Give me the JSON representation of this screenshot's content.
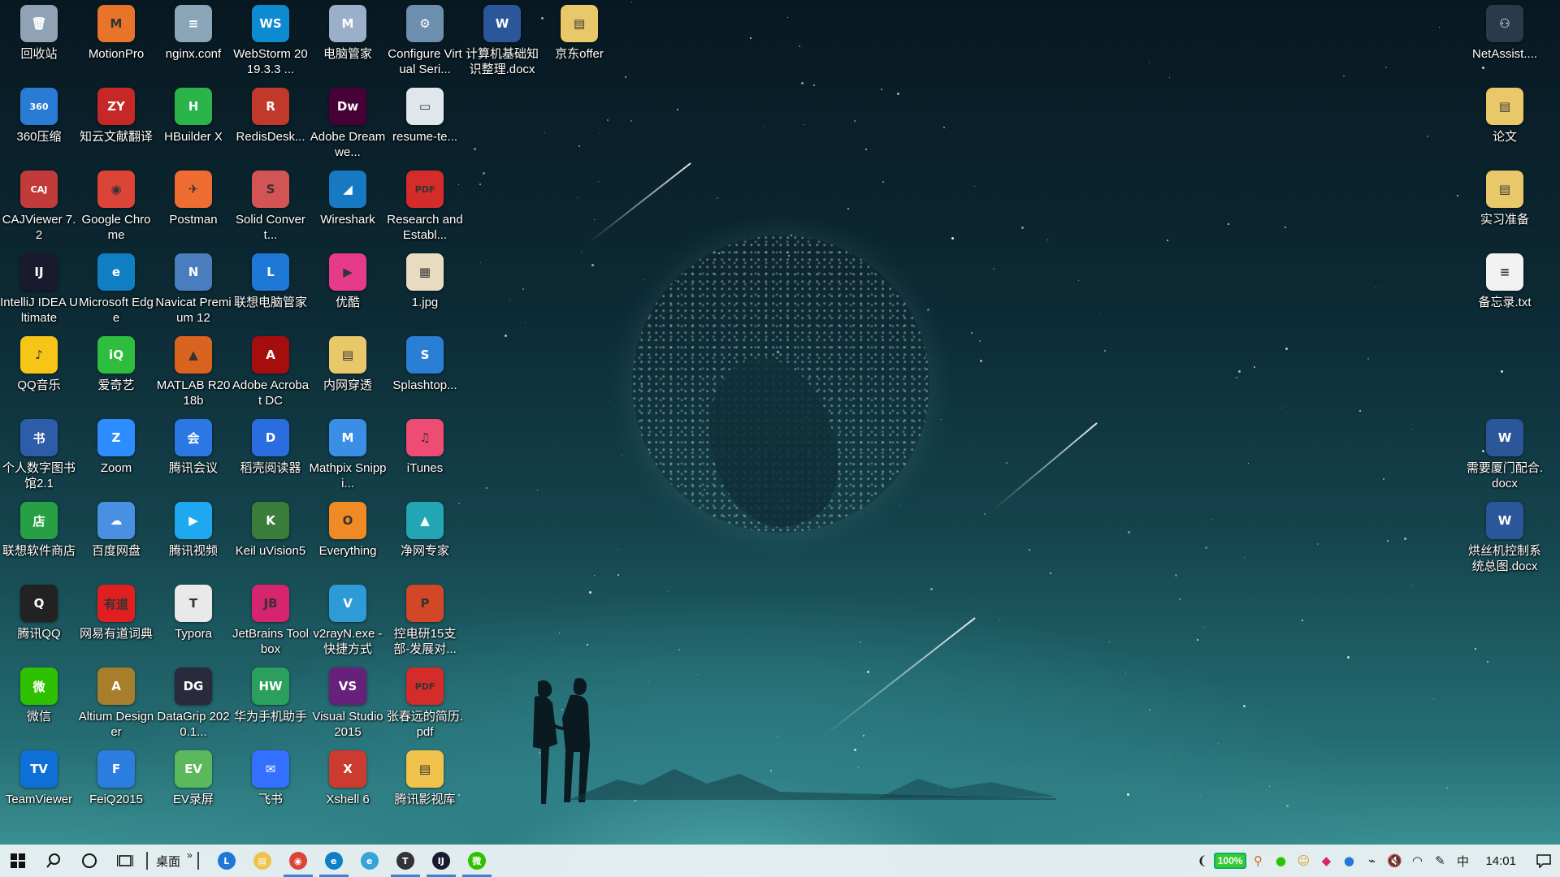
{
  "desktop": {
    "columns": [
      [
        {
          "label": "回收站",
          "icon": "recycle-bin-icon",
          "color": "#8fa3b5",
          "glyph": "🗑"
        },
        {
          "label": "360压缩",
          "icon": "360zip-icon",
          "color": "#2a7bd3",
          "glyph": "360"
        },
        {
          "label": "CAJViewer 7.2",
          "icon": "cajviewer-icon",
          "color": "#c23b3b",
          "glyph": "CAJ"
        },
        {
          "label": "IntelliJ IDEA Ultimate",
          "icon": "intellij-icon",
          "color": "#1a1a2e",
          "glyph": "IJ"
        },
        {
          "label": "QQ音乐",
          "icon": "qqmusic-icon",
          "color": "#f5c518",
          "glyph": "♪"
        },
        {
          "label": "个人数字图书馆2.1",
          "icon": "digital-library-icon",
          "color": "#2d5ca8",
          "glyph": "书"
        },
        {
          "label": "联想软件商店",
          "icon": "lenovo-store-icon",
          "color": "#27a045",
          "glyph": "店"
        },
        {
          "label": "腾讯QQ",
          "icon": "qq-icon",
          "color": "#222222",
          "glyph": "Q"
        },
        {
          "label": "微信",
          "icon": "wechat-icon",
          "color": "#2dc100",
          "glyph": "微"
        },
        {
          "label": "TeamViewer",
          "icon": "teamviewer-icon",
          "color": "#0e6fd6",
          "glyph": "TV"
        }
      ],
      [
        {
          "label": "MotionPro",
          "icon": "motionpro-icon",
          "color": "#e8742a",
          "glyph": "M"
        },
        {
          "label": "知云文献翻译",
          "icon": "zhiyun-icon",
          "color": "#c62828",
          "glyph": "ZY"
        },
        {
          "label": "Google Chrome",
          "icon": "chrome-icon",
          "color": "#db4437",
          "glyph": "◉"
        },
        {
          "label": "Microsoft Edge",
          "icon": "edge-icon",
          "color": "#0f7fc4",
          "glyph": "e"
        },
        {
          "label": "爱奇艺",
          "icon": "iqiyi-icon",
          "color": "#2fbd3f",
          "glyph": "iQ"
        },
        {
          "label": "Zoom",
          "icon": "zoom-icon",
          "color": "#2d8cff",
          "glyph": "Z"
        },
        {
          "label": "百度网盘",
          "icon": "baidu-netdisk-icon",
          "color": "#4a90e2",
          "glyph": "☁"
        },
        {
          "label": "网易有道词典",
          "icon": "youdao-icon",
          "color": "#e02020",
          "glyph": "有道"
        },
        {
          "label": "Altium Designer",
          "icon": "altium-icon",
          "color": "#a77f2c",
          "glyph": "A"
        },
        {
          "label": "FeiQ2015",
          "icon": "feiq-icon",
          "color": "#2b7de0",
          "glyph": "F"
        }
      ],
      [
        {
          "label": "nginx.conf",
          "icon": "conf-file-icon",
          "color": "#8aa6b8",
          "glyph": "≡"
        },
        {
          "label": "HBuilder X",
          "icon": "hbuilder-icon",
          "color": "#2bb44a",
          "glyph": "H"
        },
        {
          "label": "Postman",
          "icon": "postman-icon",
          "color": "#ef6c33",
          "glyph": "✈"
        },
        {
          "label": "Navicat Premium 12",
          "icon": "navicat-icon",
          "color": "#4a7dbd",
          "glyph": "N"
        },
        {
          "label": "MATLAB R2018b",
          "icon": "matlab-icon",
          "color": "#d9641f",
          "glyph": "▲"
        },
        {
          "label": "腾讯会议",
          "icon": "tencent-meeting-icon",
          "color": "#2b78e4",
          "glyph": "会"
        },
        {
          "label": "腾讯视频",
          "icon": "tencent-video-icon",
          "color": "#1fa8f0",
          "glyph": "▶"
        },
        {
          "label": "Typora",
          "icon": "typora-icon",
          "color": "#e9e9e9",
          "glyph": "T"
        },
        {
          "label": "DataGrip 2020.1...",
          "icon": "datagrip-icon",
          "color": "#2a2a3d",
          "glyph": "DG"
        },
        {
          "label": "EV录屏",
          "icon": "ev-recorder-icon",
          "color": "#5cb85c",
          "glyph": "EV"
        }
      ],
      [
        {
          "label": "WebStorm 2019.3.3 ...",
          "icon": "webstorm-icon",
          "color": "#0d8bd1",
          "glyph": "WS"
        },
        {
          "label": "RedisDesk...",
          "icon": "redis-desktop-icon",
          "color": "#c0392b",
          "glyph": "R"
        },
        {
          "label": "Solid Convert...",
          "icon": "solid-converter-icon",
          "color": "#d35454",
          "glyph": "S"
        },
        {
          "label": "联想电脑管家",
          "icon": "lenovo-manager-icon",
          "color": "#1e78d6",
          "glyph": "L"
        },
        {
          "label": "Adobe Acrobat DC",
          "icon": "acrobat-icon",
          "color": "#a60d0d",
          "glyph": "A"
        },
        {
          "label": "稻壳阅读器",
          "icon": "docer-reader-icon",
          "color": "#2a6de0",
          "glyph": "D"
        },
        {
          "label": "Keil uVision5",
          "icon": "keil-icon",
          "color": "#3a7d3a",
          "glyph": "K"
        },
        {
          "label": "JetBrains Toolbox",
          "icon": "jetbrains-toolbox-icon",
          "color": "#d6246e",
          "glyph": "JB"
        },
        {
          "label": "华为手机助手",
          "icon": "huawei-hisuite-icon",
          "color": "#2b9f5d",
          "glyph": "HW"
        },
        {
          "label": "飞书",
          "icon": "feishu-icon",
          "color": "#3370ff",
          "glyph": "✉"
        }
      ],
      [
        {
          "label": "电脑管家",
          "icon": "pc-manager-icon",
          "color": "#9bb0c8",
          "glyph": "M"
        },
        {
          "label": "Adobe Dreamwe...",
          "icon": "dreamweaver-icon",
          "color": "#470137",
          "glyph": "Dw"
        },
        {
          "label": "Wireshark",
          "icon": "wireshark-icon",
          "color": "#1679c2",
          "glyph": "◢"
        },
        {
          "label": "优酷",
          "icon": "youku-icon",
          "color": "#e63b8a",
          "glyph": "▶"
        },
        {
          "label": "内网穿透",
          "icon": "folder-icon",
          "color": "#e9c86a",
          "glyph": "▤"
        },
        {
          "label": "Mathpix Snippi...",
          "icon": "mathpix-icon",
          "color": "#3a8ee6",
          "glyph": "M"
        },
        {
          "label": "Everything",
          "icon": "everything-icon",
          "color": "#f08a24",
          "glyph": "O"
        },
        {
          "label": "v2rayN.exe - 快捷方式",
          "icon": "v2rayn-icon",
          "color": "#2e9ad6",
          "glyph": "V"
        },
        {
          "label": "Visual Studio 2015",
          "icon": "visual-studio-icon",
          "color": "#68217a",
          "glyph": "VS"
        },
        {
          "label": "Xshell 6",
          "icon": "xshell-icon",
          "color": "#cc3b2f",
          "glyph": "X"
        }
      ],
      [
        {
          "label": "Configure Virtual Seri...",
          "icon": "configure-vsp-icon",
          "color": "#6c8fae",
          "glyph": "⚙"
        },
        {
          "label": "resume-te...",
          "icon": "file-icon",
          "color": "#dfe6ec",
          "glyph": "▭"
        },
        {
          "label": "Research and Establ...",
          "icon": "pdf-icon",
          "color": "#d42b2b",
          "glyph": "PDF"
        },
        {
          "label": "1.jpg",
          "icon": "image-file-icon",
          "color": "#e8dcc0",
          "glyph": "▦"
        },
        {
          "label": "Splashtop...",
          "icon": "splashtop-icon",
          "color": "#2a7fd4",
          "glyph": "S"
        },
        {
          "label": "iTunes",
          "icon": "itunes-icon",
          "color": "#ef4c73",
          "glyph": "♫"
        },
        {
          "label": "净网专家",
          "icon": "jingwang-icon",
          "color": "#22a6b3",
          "glyph": "▲"
        },
        {
          "label": "控电研15支部-发展对...",
          "icon": "pptx-icon",
          "color": "#d24726",
          "glyph": "P"
        },
        {
          "label": "张春远的简历.pdf",
          "icon": "pdf-icon",
          "color": "#d42b2b",
          "glyph": "PDF"
        },
        {
          "label": "腾讯影视库",
          "icon": "folder-icon",
          "color": "#f0c24b",
          "glyph": "▤"
        }
      ],
      [
        {
          "label": "计算机基础知识整理.docx",
          "icon": "word-doc-icon",
          "color": "#2b579a",
          "glyph": "W"
        }
      ],
      [
        {
          "label": "京东offer",
          "icon": "folder-zip-icon",
          "color": "#e9c86a",
          "glyph": "▤"
        }
      ]
    ],
    "right_column": [
      {
        "label": "NetAssist....",
        "icon": "netassist-icon",
        "color": "#2b3a4a",
        "glyph": "⚇",
        "row": 0
      },
      {
        "label": "论文",
        "icon": "folder-zip-icon",
        "color": "#e9c86a",
        "glyph": "▤",
        "row": 1
      },
      {
        "label": "实习准备",
        "icon": "folder-zip-icon",
        "color": "#e9c86a",
        "glyph": "▤",
        "row": 2
      },
      {
        "label": "备忘录.txt",
        "icon": "text-file-icon",
        "color": "#f2f2f2",
        "glyph": "≡",
        "row": 3
      },
      {
        "label": "需要厦门配合.docx",
        "icon": "word-doc-icon",
        "color": "#2b579a",
        "glyph": "W",
        "row": 5
      },
      {
        "label": "烘丝机控制系统总图.docx",
        "icon": "word-doc-icon",
        "color": "#2b579a",
        "glyph": "W",
        "row": 6
      }
    ]
  },
  "taskbar": {
    "start_label": "Start",
    "desktop_label": "桌面",
    "more_label": "»",
    "pinned": [
      {
        "name": "lenovo-manager-icon",
        "color": "#1e78d6",
        "glyph": "L",
        "active": false
      },
      {
        "name": "file-explorer-icon",
        "color": "#f0c24b",
        "glyph": "▤",
        "active": false
      },
      {
        "name": "chrome-icon",
        "color": "#db4437",
        "glyph": "◉",
        "active": true
      },
      {
        "name": "edge-icon",
        "color": "#0f7fc4",
        "glyph": "e",
        "active": true
      },
      {
        "name": "edge-legacy-icon",
        "color": "#36a3d9",
        "glyph": "e",
        "active": false
      },
      {
        "name": "typora-icon",
        "color": "#333333",
        "glyph": "T",
        "active": true
      },
      {
        "name": "intellij-icon",
        "color": "#1a1a2e",
        "glyph": "IJ",
        "active": true
      },
      {
        "name": "wechat-icon",
        "color": "#2dc100",
        "glyph": "微",
        "active": true
      }
    ],
    "tray": {
      "battery_label": "100%",
      "ime_label": "中",
      "clock": "14:01"
    }
  }
}
